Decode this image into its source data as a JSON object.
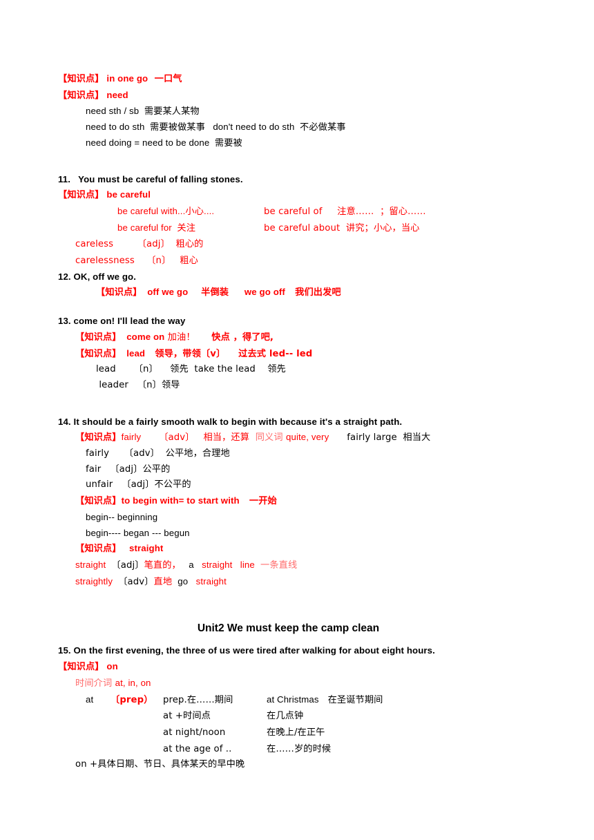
{
  "document": {
    "language": "zh-CN / en",
    "accent_color": "#FF0000",
    "light_accent_color": "#FF6A6A",
    "body_color": "#000000"
  },
  "items": {
    "kp_label": "【知识点】",
    "in_one_go": {
      "term": " in one go",
      "gloss": "  一口气"
    },
    "need": {
      "term": " need",
      "l1": "need sth / sb  需要某人某物",
      "l2_a": "need to do sth  需要被做某事",
      "l2_b": "don't need to do sth  不必做某事",
      "l3": "need doing = need to be done  需要被"
    },
    "s11": {
      "heading": "11.   You must be careful of falling stones.",
      "term": " be careful",
      "r1c1": "be careful with...小心....",
      "r1c2": "be careful of     注意……  ；留心……",
      "r2c1": "be careful for  关注",
      "r2c2": "be careful about  讲究；小心，当心",
      "r3": "careless        〔adj〕  粗心的",
      "r4": "carelessness    〔n〕   粗心"
    },
    "s12": {
      "heading": "12. OK, off we go.",
      "kp": "【知识点】",
      "t1": "  off we go",
      "t2": "    半倒装",
      "t3": "      we go off",
      "t4": "   我们出发吧"
    },
    "s13": {
      "heading": "13. come on! I'll lead the way",
      "kp1": "【知识点】",
      "come_on_term": "  come on",
      "come_on_gloss": " 加油！",
      "come_on_gloss2": "     快点 ，得了吧,",
      "kp2": "【知识点】",
      "lead_term": "  lead",
      "lead_gloss": "   领导，带领〔v〕",
      "lead_past": "    过去式 led-- led",
      "l2": "lead      〔n〕    领先  take the lead    领先",
      "l3": " leader   〔n〕领导"
    },
    "s14": {
      "heading": "14. It should be a fairly smooth walk to begin with because it's a straight path.",
      "fairly_kp": "【知识点】",
      "fairly_term": "fairly",
      "fairly_pos": "      〔adv〕",
      "fairly_gloss": "   相当，还算",
      "fairly_syn_label": "  同义词 ",
      "fairly_syn": "quite, very",
      "fairly_example": "      fairly large  相当大",
      "l2": "fairly     〔adv〕  公平地，合理地",
      "l3": "fair   〔adj〕公平的",
      "l4": "unfair   〔adj〕不公平的",
      "begin_kp": "【知识点】",
      "begin_term": "to begin with= to start with",
      "begin_gloss": "   一开始",
      "begin_l1": "begin-- beginning",
      "begin_l2": "begin---- began --- begun",
      "straight_kp": "【知识点】",
      "straight_term": "   straight",
      "st_l1_a": "straight ",
      "st_l1_pos": " 〔adj〕",
      "st_l1_b": "笔直的，",
      "st_l1_c": "   a ",
      "st_l1_d": "  straight   line ",
      "st_l1_e": " 一条直线",
      "st_l2_a": "straightly ",
      "st_l2_pos": " 〔adv〕",
      "st_l2_b": "直地 ",
      "st_l2_c": " go ",
      "st_l2_d": "  straight"
    },
    "unit2": {
      "title": "Unit2 We must keep the camp clean"
    },
    "s15": {
      "heading": "15. On the first evening, the three of us were tired after walking for about eight hours.",
      "on_kp": "【知识点】",
      "on_term": " on",
      "time_prep_cn": "时间介词 ",
      "time_prep_en": "at, in, on",
      "rows": [
        {
          "word": "at",
          "pos": "〔prep）",
          "mid": "prep.在……期间",
          "ex": "at Christmas",
          "cn": "   在圣诞节期间"
        },
        {
          "word": "",
          "pos": "",
          "mid": "at +时间点",
          "ex": "",
          "cn": "在几点钟"
        },
        {
          "word": "",
          "pos": "",
          "mid": "at night/noon",
          "ex": "",
          "cn": "在晚上/在正午"
        },
        {
          "word": "",
          "pos": "",
          "mid": "at the age of ..",
          "ex": "",
          "cn": "在……岁的时候"
        }
      ],
      "on_rule": "on +具体日期、节日、具体某天的早中晚"
    }
  }
}
